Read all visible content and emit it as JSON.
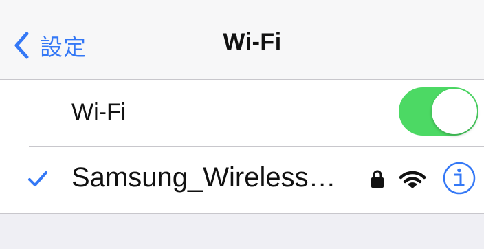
{
  "nav": {
    "back_label": "設定",
    "title": "Wi-Fi"
  },
  "wifi_toggle": {
    "label": "Wi-Fi",
    "state": "on",
    "on_color": "#4cd964"
  },
  "networks": [
    {
      "name": "Samsung_Wireless…",
      "connected": true,
      "secured": true,
      "icons": [
        "checkmark-icon",
        "lock-icon",
        "wifi-signal-icon",
        "info-icon"
      ]
    }
  ],
  "colors": {
    "accent": "#3478f6",
    "toggle_on": "#4cd964",
    "background": "#efeff4"
  }
}
